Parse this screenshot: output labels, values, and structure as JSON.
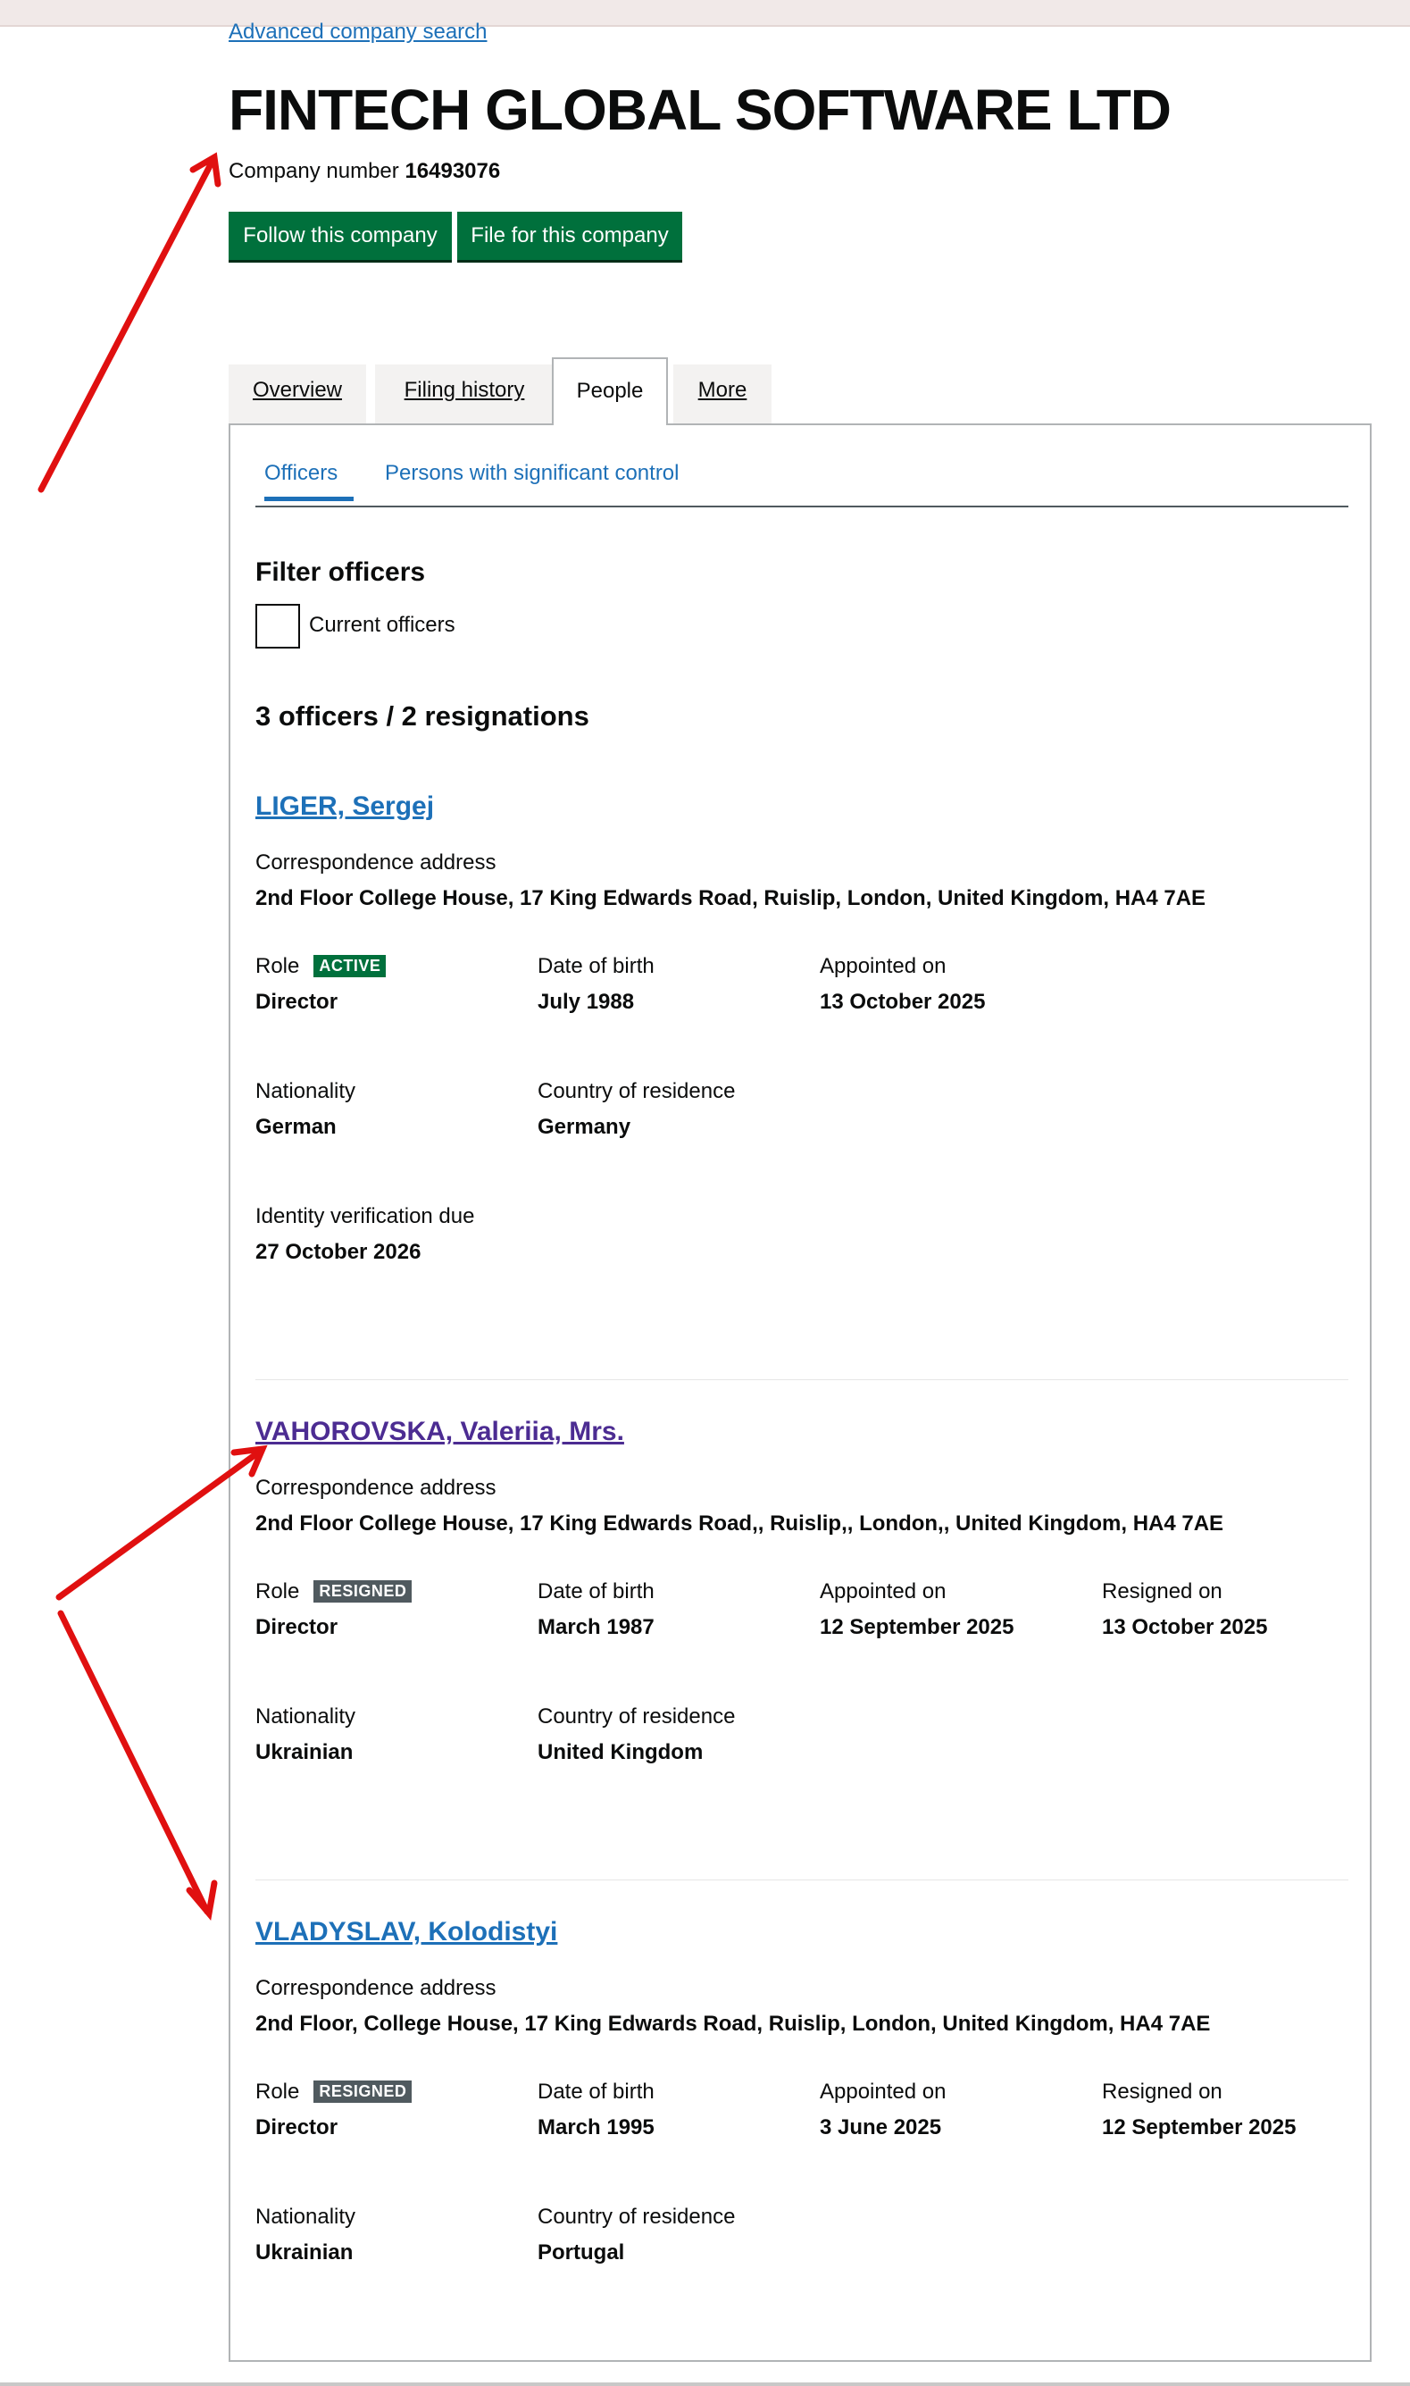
{
  "header": {
    "advanced_search_link": "Advanced company search",
    "company_name": "FINTECH GLOBAL SOFTWARE LTD",
    "company_number_label": "Company number",
    "company_number": "16493076",
    "follow_button": "Follow this company",
    "file_button": "File for this company"
  },
  "tabs": [
    {
      "label": "Overview"
    },
    {
      "label": "Filing history"
    },
    {
      "label": "People"
    },
    {
      "label": "More"
    }
  ],
  "subnav": {
    "officers": "Officers",
    "psc": "Persons with significant control"
  },
  "filter": {
    "heading": "Filter officers",
    "current_officers_label": "Current officers"
  },
  "summary": "3 officers / 2 resignations",
  "labels": {
    "correspondence_address": "Correspondence address",
    "role": "Role",
    "date_of_birth": "Date of birth",
    "appointed_on": "Appointed on",
    "resigned_on": "Resigned on",
    "nationality": "Nationality",
    "country_of_residence": "Country of residence",
    "identity_verification_due": "Identity verification due"
  },
  "officers": [
    {
      "name": "LIGER, Sergej",
      "address": "2nd Floor College House, 17 King Edwards Road, Ruislip, London, United Kingdom, HA4 7AE",
      "status": "ACTIVE",
      "role": "Director",
      "date_of_birth": "July 1988",
      "appointed_on": "13 October 2025",
      "nationality": "German",
      "country_of_residence": "Germany",
      "identity_verification_due": "27 October 2026"
    },
    {
      "name": "VAHOROVSKA, Valeriia, Mrs.",
      "address": "2nd Floor College House, 17 King Edwards Road,, Ruislip,, London,, United Kingdom, HA4 7AE",
      "status": "RESIGNED",
      "role": "Director",
      "date_of_birth": "March 1987",
      "appointed_on": "12 September 2025",
      "resigned_on": "13 October 2025",
      "nationality": "Ukrainian",
      "country_of_residence": "United Kingdom"
    },
    {
      "name": "VLADYSLAV, Kolodistyi",
      "address": "2nd Floor, College House, 17 King Edwards Road, Ruislip, London, United Kingdom, HA4 7AE",
      "status": "RESIGNED",
      "role": "Director",
      "date_of_birth": "March 1995",
      "appointed_on": "3 June 2025",
      "resigned_on": "12 September 2025",
      "nationality": "Ukrainian",
      "country_of_residence": "Portugal"
    }
  ],
  "colors": {
    "link": "#1d70b8",
    "visited_link": "#4c2c92",
    "button_green": "#00703c",
    "tag_active": "#00703c",
    "tag_resigned": "#505a5f",
    "annotation_arrow": "#e01010"
  }
}
